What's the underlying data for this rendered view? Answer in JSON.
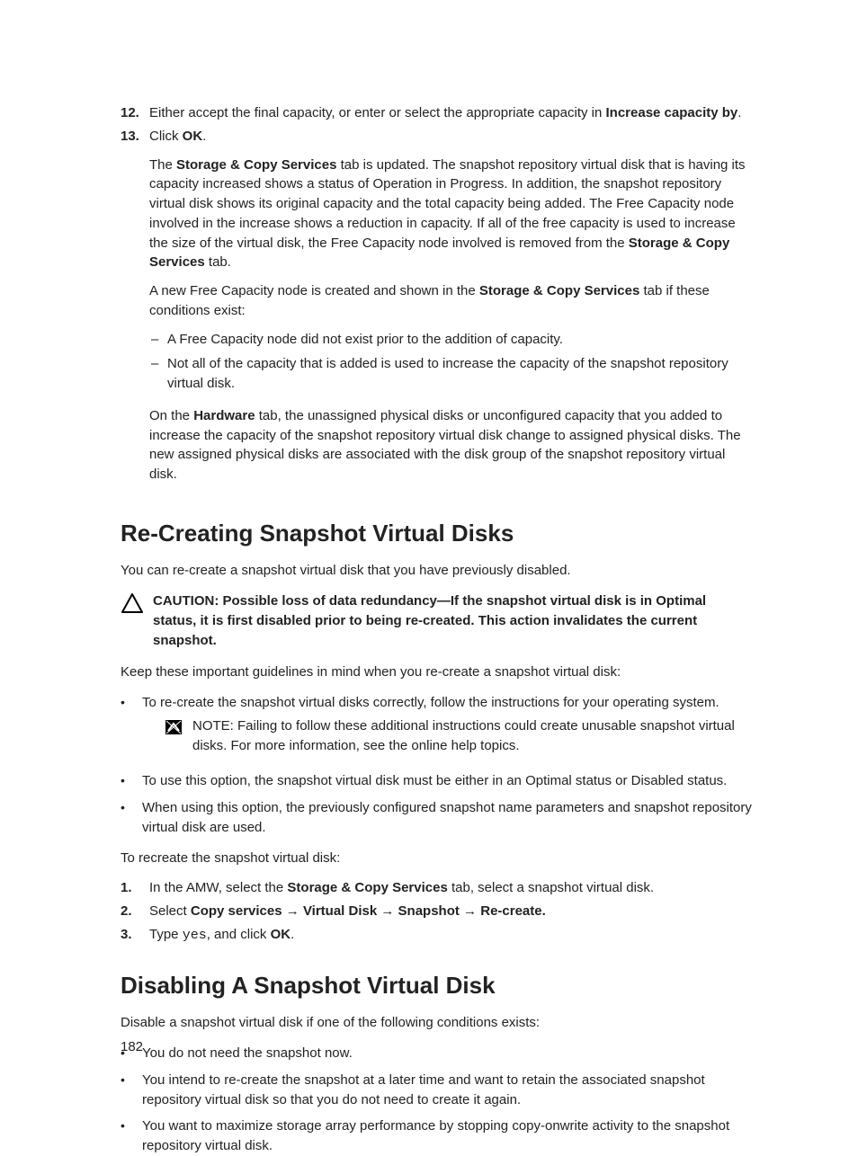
{
  "steps_top": [
    {
      "num": "12.",
      "html": "Either accept the final capacity, or enter or select the appropriate capacity in <span class='b'>Increase capacity by</span>."
    },
    {
      "num": "13.",
      "html": "Click <span class='b'>OK</span>.",
      "para1_html": "The <span class='b'>Storage & Copy Services</span> tab is updated. The snapshot repository virtual disk that is having its capacity increased shows a status of Operation in Progress. In addition, the snapshot repository virtual disk shows its original capacity and the total capacity being added. The Free Capacity node involved in the increase shows a reduction in capacity. If all of the free capacity is used to increase the size of the virtual disk, the Free Capacity node involved is removed from the <span class='b'>Storage & Copy Services</span> tab.",
      "para2_html": "A new Free Capacity node is created and shown in the <span class='b'>Storage & Copy Services</span> tab if these conditions exist:",
      "dashes": [
        "A Free Capacity node did not exist prior to the addition of capacity.",
        "Not all of the capacity that is added is used to increase the capacity of the snapshot repository virtual disk."
      ],
      "para3_html": "On the <span class='b'>Hardware</span> tab, the unassigned physical disks or unconfigured capacity that you added to increase the capacity of the snapshot repository virtual disk change to assigned physical disks. The new assigned physical disks are associated with the disk group of the snapshot repository virtual disk."
    }
  ],
  "section1": {
    "heading": "Re-Creating Snapshot Virtual Disks",
    "intro": "You can re-create a snapshot virtual disk that you have previously disabled.",
    "caution_html": "CAUTION: Possible loss of data redundancy—If the snapshot virtual disk is in Optimal status, it is first disabled prior to being re-created. This action invalidates the current snapshot.",
    "guidelines_intro": "Keep these important guidelines in mind when you re-create a snapshot virtual disk:",
    "bullets": [
      {
        "text": "To re-create the snapshot virtual disks correctly, follow the instructions for your operating system.",
        "note_html": "NOTE: Failing to follow these additional instructions could create unusable snapshot virtual disks. For more information, see the online help topics."
      },
      {
        "text": "To use this option, the snapshot virtual disk must be either in an Optimal status or Disabled status."
      },
      {
        "text": "When using this option, the previously configured snapshot name parameters and snapshot repository virtual disk are used."
      }
    ],
    "recreate_intro": "To recreate the snapshot virtual disk:",
    "steps": [
      {
        "num": "1.",
        "html": "In the AMW, select the <span class='b'>Storage & Copy Services</span> tab, select a snapshot virtual disk."
      },
      {
        "num": "2.",
        "html": "Select <span class='b'>Copy services</span> → <span class='b'>Virtual Disk</span> → <span class='b'>Snapshot</span> → <span class='b'>Re-create.</span>"
      },
      {
        "num": "3.",
        "html": "Type <span class='mono'>yes</span>, and click <span class='b'>OK</span>."
      }
    ]
  },
  "section2": {
    "heading": "Disabling A Snapshot Virtual Disk",
    "intro": "Disable a snapshot virtual disk if one of the following conditions exists:",
    "bullets": [
      "You do not need the snapshot now.",
      "You intend to re-create the snapshot at a later time and want to retain the associated snapshot repository virtual disk so that you do not need to create it again.",
      "You want to maximize storage array performance by stopping copy-onwrite activity to the snapshot repository virtual disk."
    ]
  },
  "page_number": "182"
}
